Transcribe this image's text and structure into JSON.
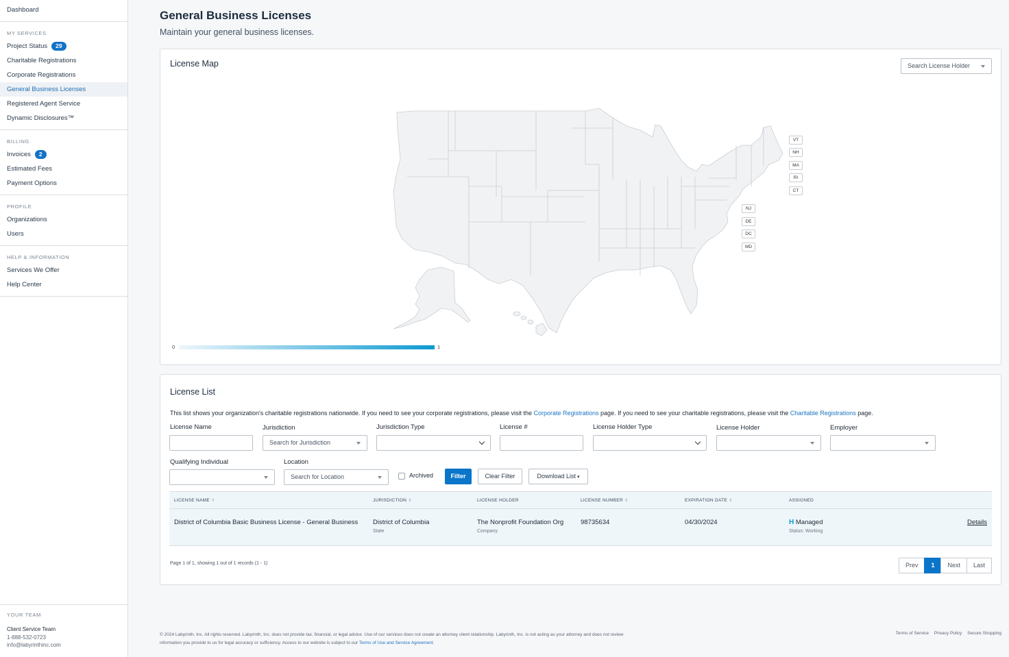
{
  "sidebar": {
    "top": {
      "dashboard": "Dashboard"
    },
    "sections": [
      {
        "heading": "MY SERVICES",
        "items": [
          {
            "label": "Project Status",
            "badge": "29"
          },
          {
            "label": "Charitable Registrations"
          },
          {
            "label": "Corporate Registrations"
          },
          {
            "label": "General Business Licenses",
            "active": true
          },
          {
            "label": "Registered Agent Service"
          },
          {
            "label": "Dynamic Disclosures™"
          }
        ]
      },
      {
        "heading": "BILLING",
        "items": [
          {
            "label": "Invoices",
            "badge": "2"
          },
          {
            "label": "Estimated Fees"
          },
          {
            "label": "Payment Options"
          }
        ]
      },
      {
        "heading": "PROFILE",
        "items": [
          {
            "label": "Organizations"
          },
          {
            "label": "Users"
          }
        ]
      },
      {
        "heading": "HELP & INFORMATION",
        "items": [
          {
            "label": "Services We Offer"
          },
          {
            "label": "Help Center"
          }
        ]
      }
    ],
    "team": {
      "heading": "YOUR TEAM",
      "name": "Client Service Team",
      "phone": "1-888-532-0723",
      "email": "info@labyrinthinc.com"
    }
  },
  "page": {
    "title": "General Business Licenses",
    "subtitle": "Maintain your general business licenses."
  },
  "map_card": {
    "title": "License Map",
    "holder_select": "Search License Holder",
    "state_tags_ne": [
      "VT",
      "NH",
      "MA",
      "RI",
      "CT"
    ],
    "state_tags_mid": [
      "NJ",
      "DE",
      "DC",
      "MD"
    ],
    "legend_min": "0",
    "legend_max": "1",
    "colors": {
      "base": "#f1f2f4",
      "border": "#c9ced4",
      "legend_end": "#0c9ad2"
    }
  },
  "list_card": {
    "title": "License List",
    "desc_before": "This list shows your organization's charitable registrations nationwide. If you need to see your corporate registrations, please visit the ",
    "link1": "Corporate Registrations",
    "desc_mid": " page. If you need to see your charitable registrations, please visit the ",
    "link2": "Charitable Registrations",
    "desc_after": " page.",
    "filters": {
      "license_name": "License Name",
      "jurisdiction": "Jurisdiction",
      "jurisdiction_placeholder": "Search for Jurisdiction",
      "jurisdiction_type": "Jurisdiction Type",
      "license_num": "License #",
      "holder_type": "License Holder Type",
      "holder": "License Holder",
      "employer": "Employer",
      "qualifying": "Qualifying Individual",
      "location": "Location",
      "location_placeholder": "Search for Location",
      "archived": "Archived",
      "filter_btn": "Filter",
      "clear_btn": "Clear Filter",
      "download_btn": "Download List"
    },
    "columns": [
      "LICENSE NAME",
      "JURISDICTION",
      "LICENSE HOLDER",
      "LICENSE NUMBER",
      "EXPIRATION DATE",
      "ASSIGNED"
    ],
    "rows": [
      {
        "name": "District of Columbia Basic Business License - General Business",
        "jurisdiction": "District of Columbia",
        "jurisdiction_type": "State",
        "holder": "The Nonprofit Foundation Org",
        "holder_type": "Company",
        "number": "98735634",
        "expiration": "04/30/2024",
        "assigned": "Managed",
        "status": "Status: Working",
        "details": "Details"
      }
    ],
    "page_info": "Page 1 of 1, showing 1 out of 1 records (1 - 1)",
    "pager": {
      "prev": "Prev",
      "current": "1",
      "next": "Next",
      "last": "Last"
    }
  },
  "footer": {
    "text1": "© 2024 Labyrinth, Inc. All rights reserved. Labyrinth, Inc. does not provide tax, financial, or legal advice. Use of our services does not create an attorney  client relationship. Labyrinth, Inc. is not acting as your attorney and does not review",
    "text2": "information you provide to us for legal accuracy or sufficiency. Access to our website is subject to our ",
    "terms_link": "Terms of Use and Service Agreement",
    "links": [
      "Terms of Service",
      "Privacy Policy",
      "Secure Shopping"
    ]
  }
}
